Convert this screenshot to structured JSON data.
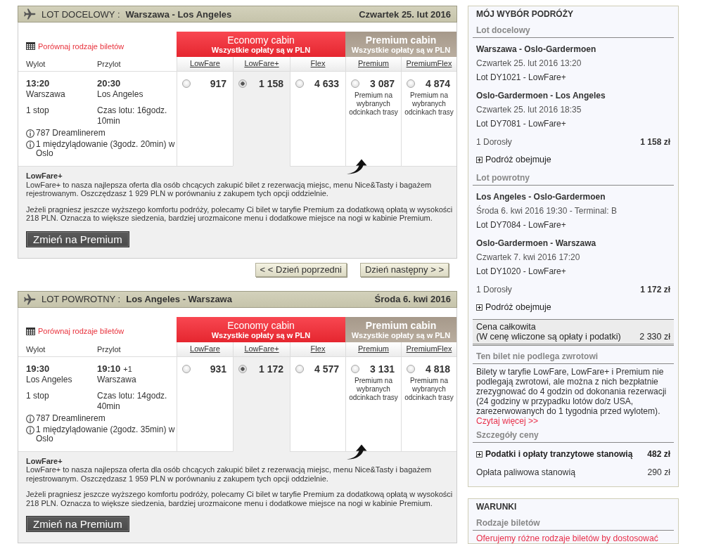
{
  "outbound": {
    "direction": "LOT DOCELOWY :",
    "route": "Warszawa - Los Angeles",
    "date": "Czwartek 25. lut 2016",
    "compare_link": "Porównaj rodzaje biletów",
    "departure_label": "Wylot",
    "arrival_label": "Przylot",
    "cabins": [
      {
        "kind": "economy",
        "name": "Economy cabin",
        "note": "Wszystkie opłaty są w PLN",
        "fares": [
          {
            "label": "LowFare",
            "price": "917",
            "selected": false
          },
          {
            "label": "LowFare+",
            "price": "1 158",
            "selected": true
          },
          {
            "label": "Flex",
            "price": "4 633",
            "selected": false
          }
        ]
      },
      {
        "kind": "premium",
        "name": "Premium cabin",
        "note": "Wszystkie opłaty są w PLN",
        "fares": [
          {
            "label": "Premium",
            "price": "3 087",
            "note": "Premium na wybranych odcinkach trasy",
            "selected": false
          },
          {
            "label": "PremiumFlex",
            "price": "4 874",
            "note": "Premium na wybranych odcinkach trasy",
            "selected": false
          }
        ]
      }
    ],
    "departure_time": "13:20",
    "departure_city": "Warszawa",
    "stops": "1 stop",
    "arrival_time": "20:30",
    "arrival_city": "Los Angeles",
    "duration": "Czas lotu: 16godz. 10min",
    "info": [
      "787 Dreamlinerem",
      "1 międzylądowanie (3godz. 20min) w Oslo"
    ],
    "description_title": "LowFare+",
    "description": [
      "LowFare+ to nasza najlepsza oferta dla osób chcących zakupić bilet z rezerwacją miejsc, menu Nice&Tasty i bagażem rejestrowanym. Oszczędzasz 1 929 PLN w porównaniu z zakupem tych opcji oddzielnie.",
      "Jeżeli pragniesz jeszcze wyższego komfortu podróży, polecamy Ci bilet w taryfie Premium za dodatkową opłatą w wysokości 218 PLN. Oznacza to większe siedzenia, bardziej urozmaicone menu i dodatkowe miejsce na nogi w kabinie Premium."
    ],
    "upgrade_button": "Zmień na Premium"
  },
  "day_nav": [
    "< < Dzień poprzedni",
    "Dzień następny > >"
  ],
  "return": {
    "direction": "LOT POWROTNY :",
    "route": "Los Angeles - Warszawa",
    "date": "Środa 6. kwi 2016",
    "compare_link": "Porównaj rodzaje biletów",
    "departure_label": "Wylot",
    "arrival_label": "Przylot",
    "cabins": [
      {
        "kind": "economy",
        "name": "Economy cabin",
        "note": "Wszystkie opłaty są w PLN",
        "fares": [
          {
            "label": "LowFare",
            "price": "931",
            "selected": false
          },
          {
            "label": "LowFare+",
            "price": "1 172",
            "selected": true
          },
          {
            "label": "Flex",
            "price": "4 577",
            "selected": false
          }
        ]
      },
      {
        "kind": "premium",
        "name": "Premium cabin",
        "note": "Wszystkie opłaty są w PLN",
        "fares": [
          {
            "label": "Premium",
            "price": "3 131",
            "note": "Premium na wybranych odcinkach trasy",
            "selected": false
          },
          {
            "label": "PremiumFlex",
            "price": "4 818",
            "note": "Premium na wybranych odcinkach trasy",
            "selected": false
          }
        ]
      }
    ],
    "departure_time": "19:30",
    "departure_city": "Los Angeles",
    "stops": "1 stop",
    "arrival_time": "19:10",
    "arrival_day_offset": "+1",
    "arrival_city": "Warszawa",
    "duration": "Czas lotu: 14godz. 40min",
    "info": [
      "787 Dreamlinerem",
      "1 międzylądowanie (2godz. 35min) w Oslo"
    ],
    "description_title": "LowFare+",
    "description": [
      "LowFare+ to nasza najlepsza oferta dla osób chcących zakupić bilet z rezerwacją miejsc, menu Nice&Tasty i bagażem rejestrowanym. Oszczędzasz 1 959 PLN w porównaniu z zakupem tych opcji oddzielnie.",
      "Jeżeli pragniesz jeszcze wyższego komfortu podróży, polecamy Ci bilet w taryfie Premium za dodatkową opłatą w wysokości 218 PLN. Oznacza to większe siedzenia, bardziej urozmaicone menu i dodatkowe miejsce na nogi w kabinie Premium."
    ],
    "upgrade_button": "Zmień na Premium"
  },
  "trip_summary": {
    "title": "MÓJ WYBÓR PODRÓŻY",
    "legs": [
      {
        "heading": "Lot docelowy",
        "segments": [
          {
            "route": "Warszawa - Oslo-Gardermoen",
            "departure": "Czwartek 25. lut 2016 13:20",
            "flight": "Lot DY1021 - LowFare+"
          },
          {
            "route": "Oslo-Gardermoen - Los Angeles",
            "departure": "Czwartek 25. lut 2016 18:35",
            "flight": "Lot DY7081 - LowFare+"
          }
        ],
        "passengers": "1 Dorosły",
        "price": "1 158 zł",
        "includes": {
          "label": "Podróż obejmuje",
          "expanded": false
        }
      },
      {
        "heading": "Lot powrotny",
        "segments": [
          {
            "route": "Los Angeles - Oslo-Gardermoen",
            "departure": "Środa 6. kwi 2016 19:30 - Terminal: B",
            "flight": "Lot DY7084 - LowFare+"
          },
          {
            "route": "Oslo-Gardermoen - Warszawa",
            "departure": "Czwartek 7. kwi 2016 17:20",
            "flight": "Lot DY1020 - LowFare+"
          }
        ],
        "passengers": "1 Dorosły",
        "price": "1 172 zł",
        "includes": {
          "label": "Podróż obejmuje",
          "expanded": false
        }
      }
    ],
    "total": {
      "label": "Cena całkowita",
      "note": "(W cenę wliczone są opłaty i podatki)",
      "price": "2 330 zł"
    },
    "refund": {
      "heading": "Ten bilet nie podlega zwrotowi",
      "text": "Bilety w taryfie LowFare, LowFare+ i Premium nie podlegają zwrotowi, ale można z nich bezpłatnie zrezygnować do 4 godzin od dokonania rezerwacji (24 godziny w przypadku lotów do/z USA, zarezerwowanych do 1 tygodnia przed wylotem).",
      "link": "Czytaj więcej >>"
    },
    "price_details": {
      "heading": "Szczegóły ceny",
      "rows": [
        {
          "kind": "expandable",
          "label": "Podatki i opłaty tranzytowe stanowią",
          "value": "482 zł",
          "expanded": false
        },
        {
          "kind": "plain",
          "label": "Opłata paliwowa stanowią",
          "value": "290 zł"
        }
      ]
    }
  },
  "conditions": {
    "title": "WARUNKI",
    "heading": "Rodzaje biletów",
    "text": "Oferujemy różne rodzaje biletów by dostosować"
  }
}
